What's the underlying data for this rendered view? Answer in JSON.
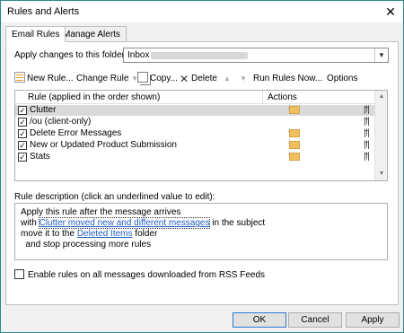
{
  "window": {
    "title": "Rules and Alerts",
    "close_glyph": "✕"
  },
  "tabs": [
    {
      "label": "Email Rules",
      "active": true
    },
    {
      "label": "Manage Alerts",
      "active": false
    }
  ],
  "folder": {
    "label": "Apply changes to this folder:",
    "value": "Inbox"
  },
  "toolbar": {
    "new_rule": "New Rule...",
    "change_rule": "Change Rule",
    "copy": "Copy...",
    "delete": "Delete",
    "run_rules_now": "Run Rules Now...",
    "options": "Options"
  },
  "rules_list": {
    "col_rule": "Rule (applied in the order shown)",
    "col_actions": "Actions",
    "rows": [
      {
        "name": "Clutter",
        "checked": true,
        "selected": true,
        "has_action_icon": true
      },
      {
        "name": "/ou  (client-only)",
        "checked": true,
        "selected": false,
        "has_action_icon": false
      },
      {
        "name": "Delete Error Messages",
        "checked": true,
        "selected": false,
        "has_action_icon": true
      },
      {
        "name": "New or Updated Product Submission",
        "checked": true,
        "selected": false,
        "has_action_icon": true
      },
      {
        "name": "Stats",
        "checked": true,
        "selected": false,
        "has_action_icon": true
      }
    ]
  },
  "description": {
    "label": "Rule description (click an underlined value to edit):",
    "line1": "Apply this rule after the message arrives",
    "line2_pre": "with ",
    "line2_link": "Clutter moved new and different messages",
    "line2_post": " in the subject",
    "line3_pre": "move it to the ",
    "line3_link": "Deleted Items",
    "line3_post": " folder",
    "line4": "  and stop processing more rules"
  },
  "rss": {
    "label": "Enable rules on all messages downloaded from RSS Feeds",
    "checked": false
  },
  "buttons": {
    "ok": "OK",
    "cancel": "Cancel",
    "apply": "Apply"
  },
  "colors": {
    "accent": "#2b8a8a",
    "link": "#1f5fbf",
    "selected_row": "#d9d9d9"
  }
}
